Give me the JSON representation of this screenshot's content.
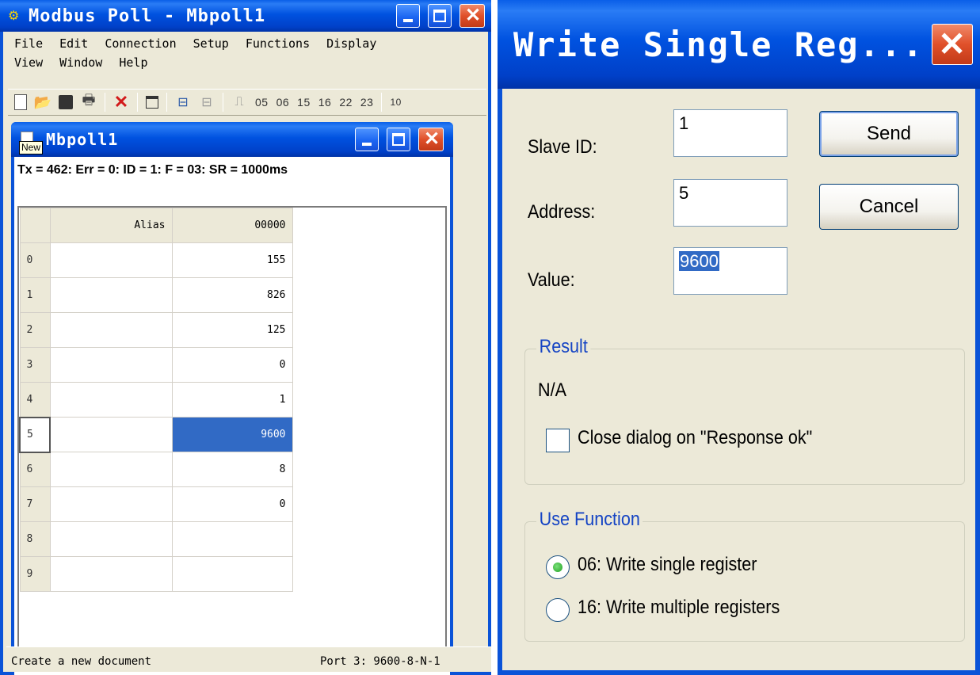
{
  "main_window": {
    "title": "Modbus Poll - Mbpoll1",
    "menu_row1": [
      "File",
      "Edit",
      "Connection",
      "Setup",
      "Functions",
      "Display"
    ],
    "menu_row2": [
      "View",
      "Window",
      "Help"
    ],
    "toolbar_functions": [
      "05",
      "06",
      "15",
      "16",
      "22",
      "23"
    ],
    "toolbar_overflow": "10",
    "status_left": "Create a new document",
    "status_right": "Port 3: 9600-8-N-1"
  },
  "child_window": {
    "title": "Mbpoll1",
    "tooltip": "New",
    "status_line": "Tx = 462: Err = 0: ID = 1: F = 03: SR = 1000ms",
    "columns": [
      "Alias",
      "00000"
    ],
    "rows": [
      {
        "index": "0",
        "alias": "",
        "value": "155"
      },
      {
        "index": "1",
        "alias": "",
        "value": "826"
      },
      {
        "index": "2",
        "alias": "",
        "value": "125"
      },
      {
        "index": "3",
        "alias": "",
        "value": "0"
      },
      {
        "index": "4",
        "alias": "",
        "value": "1"
      },
      {
        "index": "5",
        "alias": "",
        "value": "9600"
      },
      {
        "index": "6",
        "alias": "",
        "value": "8"
      },
      {
        "index": "7",
        "alias": "",
        "value": "0"
      },
      {
        "index": "8",
        "alias": "",
        "value": ""
      },
      {
        "index": "9",
        "alias": "",
        "value": ""
      }
    ],
    "selected_row": 5
  },
  "dialog": {
    "title": "Write Single Reg...",
    "slave_id_label": "Slave ID:",
    "slave_id_value": "1",
    "address_label": "Address:",
    "address_value": "5",
    "value_label": "Value:",
    "value_value": "9600",
    "send_label": "Send",
    "cancel_label": "Cancel",
    "result_group": "Result",
    "result_value": "N/A",
    "close_on_ok_label": "Close dialog on \"Response ok\"",
    "close_on_ok_checked": false,
    "function_group": "Use Function",
    "option_06": "06: Write single register",
    "option_16": "16: Write multiple registers",
    "selected_function": "06"
  },
  "colors": {
    "xp_blue": "#0a53d8",
    "face": "#ece9d8",
    "selection": "#316ac5",
    "close_red": "#e0502a"
  }
}
